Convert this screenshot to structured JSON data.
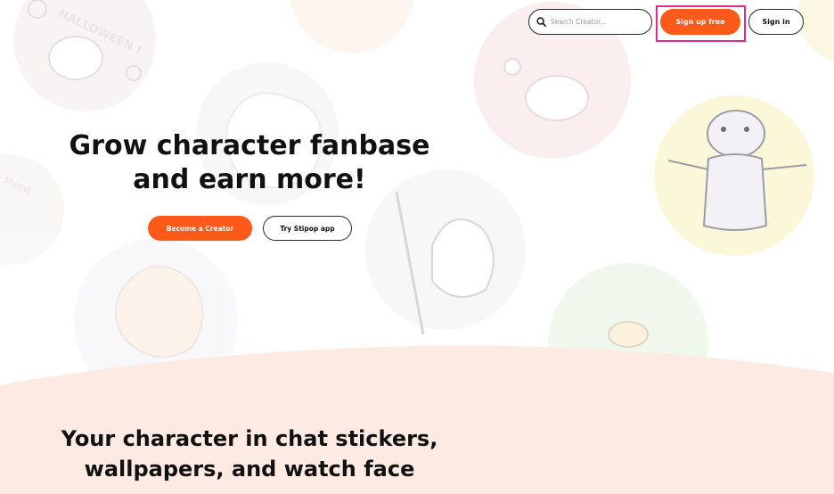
{
  "header": {
    "search": {
      "placeholder": "Search Creator...",
      "value": ""
    },
    "signup_label": "Sign up free",
    "signin_label": "Sign in"
  },
  "hero": {
    "title_lines": [
      "Grow character fanbase",
      "and earn more!"
    ],
    "primary_button": "Become a Creator",
    "secondary_button": "Try Stipop app"
  },
  "section2": {
    "title_lines": [
      "Your character in chat stickers,",
      "wallpapers, and watch face"
    ]
  },
  "background": {
    "sticker_texts": [
      "HALLOWEEN !",
      "Maow"
    ]
  },
  "colors": {
    "accent": "#ff5a1a",
    "highlight_outline": "#e4288f",
    "section_bg": "#fdebe3"
  },
  "icons": {
    "search": "search-icon"
  }
}
